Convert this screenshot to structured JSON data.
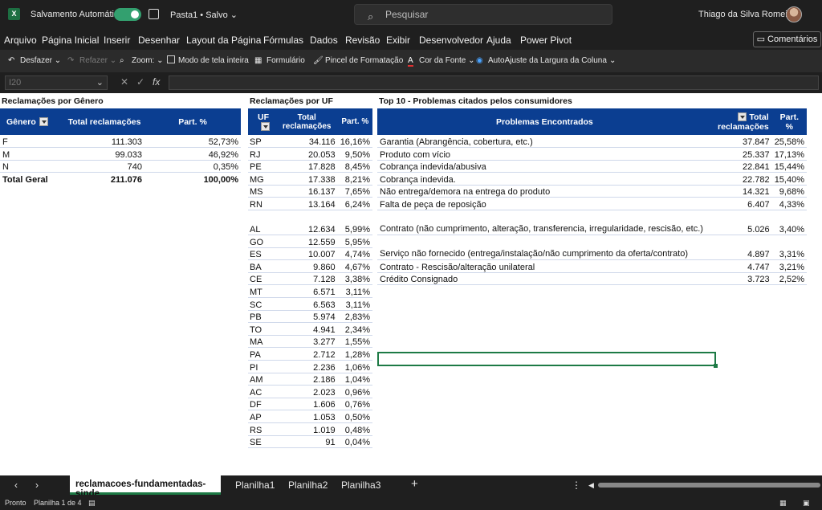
{
  "titlebar": {
    "autosave_label": "Salvamento Automático",
    "doc_name": "Pasta1 • Salvo ⌄",
    "search_placeholder": "Pesquisar",
    "user_name": "Thiago da Silva Romeiro"
  },
  "menu": [
    "Arquivo",
    "Página Inicial",
    "Inserir",
    "Desenhar",
    "Layout da Página",
    "Fórmulas",
    "Dados",
    "Revisão",
    "Exibir",
    "Desenvolvedor",
    "Ajuda",
    "Power Pivot"
  ],
  "comments_label": "Comentários",
  "toolbar": {
    "undo": "Desfazer ⌄",
    "redo": "Refazer ⌄",
    "zoom": "Zoom: ⌄",
    "fullscreen": "Modo de tela inteira",
    "form": "Formulário",
    "format_painter": "Pincel de Formatação",
    "font_color": "Cor da Fonte ⌄",
    "autofit": "AutoAjuste da Largura da Coluna",
    "more": "⌄"
  },
  "formula_bar": {
    "name_box": "I20",
    "fx": "fx",
    "value": ""
  },
  "genero": {
    "title": "Reclamações por Gênero",
    "headers": [
      "Gênero",
      "Total reclamações",
      "Part. %"
    ],
    "rows": [
      [
        "F",
        "111.303",
        "52,73%"
      ],
      [
        "M",
        "99.033",
        "46,92%"
      ],
      [
        "N",
        "740",
        "0,35%"
      ]
    ],
    "total": [
      "Total Geral",
      "211.076",
      "100,00%"
    ]
  },
  "uf": {
    "title": "Reclamações por UF",
    "headers": [
      "UF",
      "Total reclamações",
      "Part. %"
    ],
    "rows": [
      [
        "SP",
        "34.116",
        "16,16%"
      ],
      [
        "RJ",
        "20.053",
        "9,50%"
      ],
      [
        "PE",
        "17.828",
        "8,45%"
      ],
      [
        "MG",
        "17.338",
        "8,21%"
      ],
      [
        "MS",
        "16.137",
        "7,65%"
      ],
      [
        "RN",
        "13.164",
        "6,24%"
      ],
      [
        "AL",
        "12.634",
        "5,99%"
      ],
      [
        "GO",
        "12.559",
        "5,95%"
      ],
      [
        "ES",
        "10.007",
        "4,74%"
      ],
      [
        "BA",
        "9.860",
        "4,67%"
      ],
      [
        "CE",
        "7.128",
        "3,38%"
      ],
      [
        "MT",
        "6.571",
        "3,11%"
      ],
      [
        "SC",
        "6.563",
        "3,11%"
      ],
      [
        "PB",
        "5.974",
        "2,83%"
      ],
      [
        "TO",
        "4.941",
        "2,34%"
      ],
      [
        "MA",
        "3.277",
        "1,55%"
      ],
      [
        "PA",
        "2.712",
        "1,28%"
      ],
      [
        "PI",
        "2.236",
        "1,06%"
      ],
      [
        "AM",
        "2.186",
        "1,04%"
      ],
      [
        "AC",
        "2.023",
        "0,96%"
      ],
      [
        "DF",
        "1.606",
        "0,76%"
      ],
      [
        "AP",
        "1.053",
        "0,50%"
      ],
      [
        "RS",
        "1.019",
        "0,48%"
      ],
      [
        "SE",
        "91",
        "0,04%"
      ]
    ]
  },
  "top10": {
    "title": "Top 10 - Problemas citados pelos consumidores",
    "headers": [
      "Problemas Encontrados",
      "Total reclamações",
      "Part. %"
    ],
    "rows": [
      [
        "Garantia (Abrangência, cobertura, etc.)",
        "37.847",
        "25,58%"
      ],
      [
        "Produto com vício",
        "25.337",
        "17,13%"
      ],
      [
        "Cobrança indevida/abusiva",
        "22.841",
        "15,44%"
      ],
      [
        "Cobrança indevida.",
        "22.782",
        "15,40%"
      ],
      [
        "Não entrega/demora na entrega do produto",
        "14.321",
        "9,68%"
      ],
      [
        "Falta de peça de reposição",
        "6.407",
        "4,33%"
      ],
      [
        "Contrato (não cumprimento, alteração, transferencia, irregularidade, rescisão, etc.)",
        "5.026",
        "3,40%"
      ],
      [
        "Serviço não fornecido (entrega/instalação/não cumprimento da oferta/contrato)",
        "4.897",
        "3,31%"
      ],
      [
        "Contrato - Rescisão/alteração unilateral",
        "4.747",
        "3,21%"
      ],
      [
        "Crédito Consignado",
        "3.723",
        "2,52%"
      ]
    ]
  },
  "sheets": {
    "active": "reclamacoes-fundamentadas-sinde",
    "others": [
      "Planilha1",
      "Planilha2",
      "Planilha3"
    ],
    "add": "+"
  },
  "status": {
    "ready": "Pronto",
    "sheet_info": "Planilha 1 de 4"
  }
}
